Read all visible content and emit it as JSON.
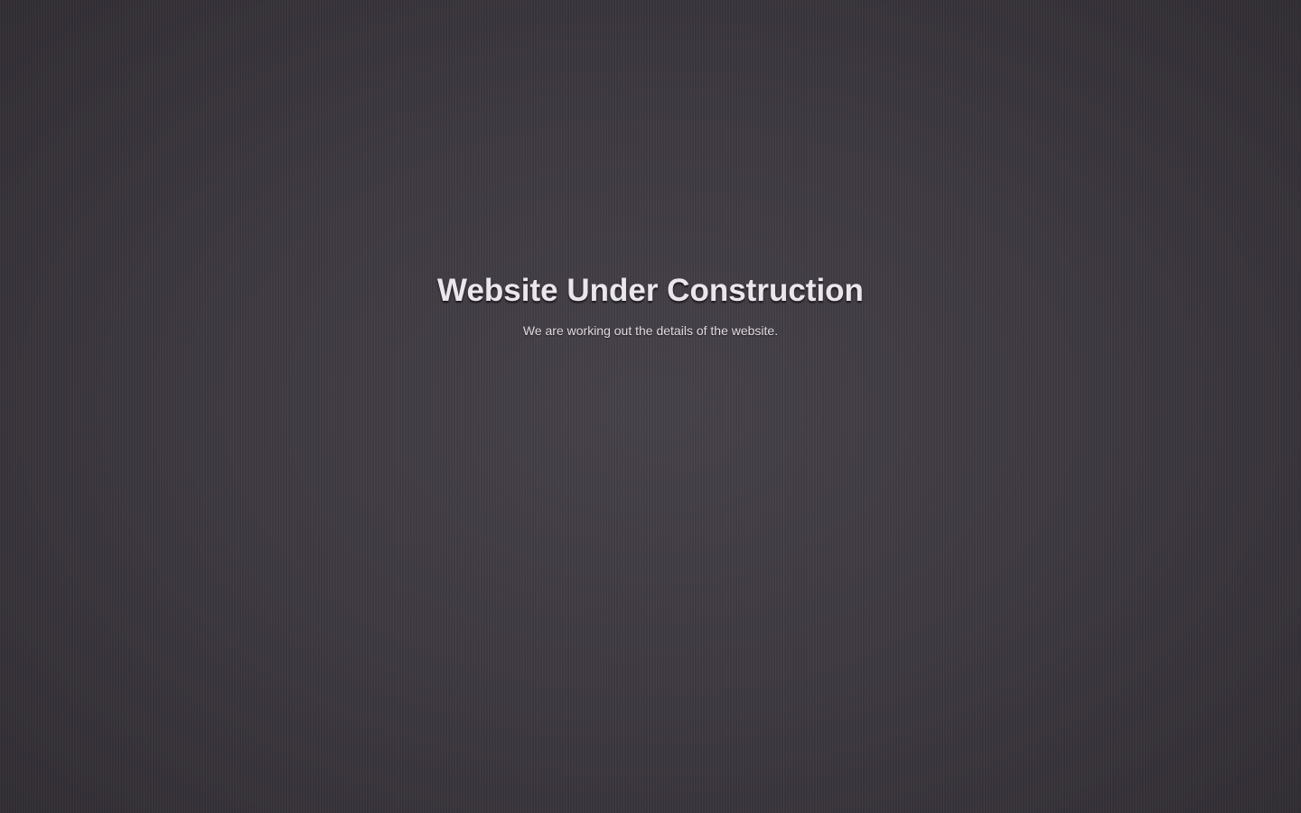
{
  "page": {
    "background_color": "#403b43",
    "text_color": "#ebe5ec"
  },
  "main": {
    "title": "Website Under Construction",
    "subtitle": "We are working out the details of the website."
  }
}
